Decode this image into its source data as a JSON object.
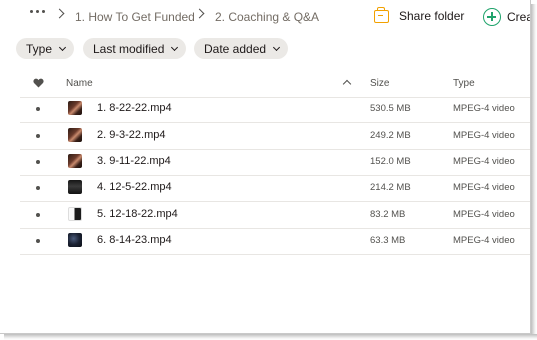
{
  "breadcrumb": {
    "items": [
      {
        "label": "1. How To Get Funded"
      },
      {
        "label": "2. Coaching & Q&A"
      }
    ]
  },
  "toolbar": {
    "share_label": "Share folder",
    "create_label": "Crea"
  },
  "filters": [
    {
      "label": "Type"
    },
    {
      "label": "Last modified"
    },
    {
      "label": "Date added"
    }
  ],
  "table": {
    "columns": {
      "name": "Name",
      "size": "Size",
      "type": "Type"
    },
    "rows": [
      {
        "name": "1. 8-22-22.mp4",
        "size": "530.5 MB",
        "type": "MPEG-4 video",
        "thumb": "portrait"
      },
      {
        "name": "2. 9-3-22.mp4",
        "size": "249.2 MB",
        "type": "MPEG-4 video",
        "thumb": "portrait"
      },
      {
        "name": "3. 9-11-22.mp4",
        "size": "152.0 MB",
        "type": "MPEG-4 video",
        "thumb": "portrait"
      },
      {
        "name": "4. 12-5-22.mp4",
        "size": "214.2 MB",
        "type": "MPEG-4 video",
        "thumb": "dark"
      },
      {
        "name": "5. 12-18-22.mp4",
        "size": "83.2 MB",
        "type": "MPEG-4 video",
        "thumb": "white"
      },
      {
        "name": "6. 8-14-23.mp4",
        "size": "63.3 MB",
        "type": "MPEG-4 video",
        "thumb": "night"
      }
    ]
  },
  "colors": {
    "accent_share": "#f2a100",
    "accent_create": "#1fa36b",
    "chip_bg": "#ebe9e6"
  },
  "icons": {
    "more": "more-horizontal-icon",
    "share": "shared-folder-icon",
    "create": "plus-circle-icon",
    "favorite_column": "heart-icon",
    "sort": "sort-ascending-icon"
  }
}
